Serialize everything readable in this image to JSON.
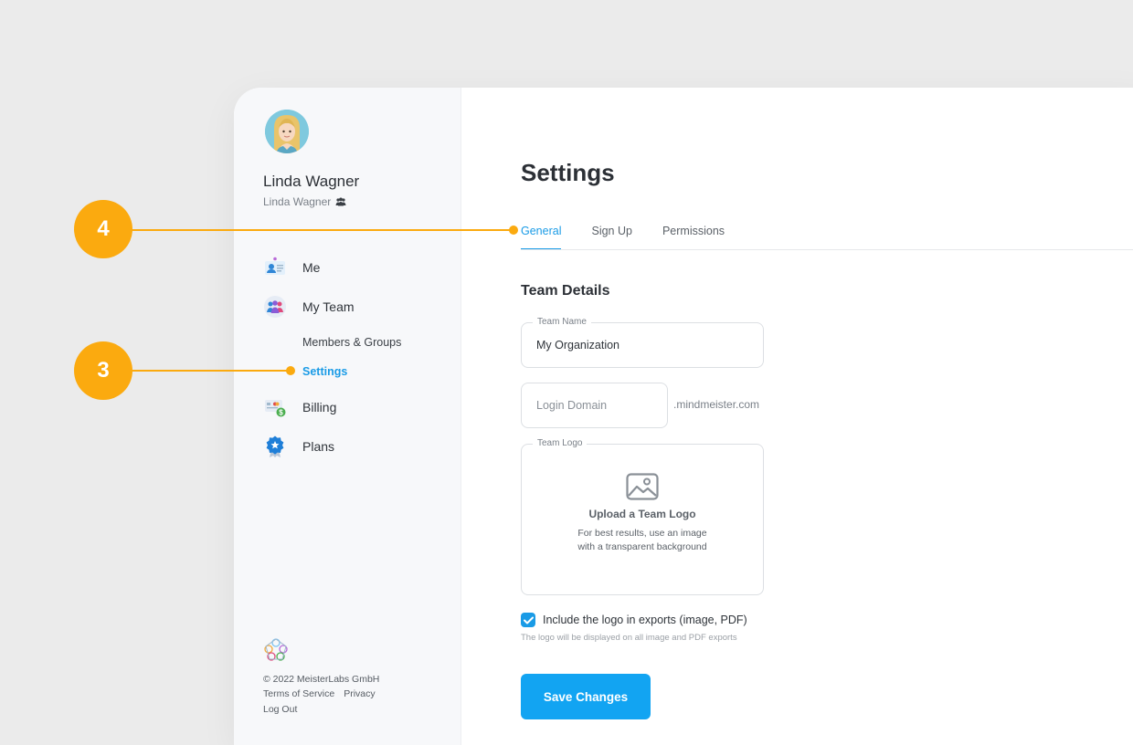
{
  "user": {
    "name": "Linda Wagner",
    "subtitle": "Linda Wagner"
  },
  "sidebar": {
    "items": [
      {
        "label": "Me"
      },
      {
        "label": "My Team"
      },
      {
        "label": "Billing"
      },
      {
        "label": "Plans"
      }
    ],
    "subitems": [
      {
        "label": "Members & Groups"
      },
      {
        "label": "Settings"
      }
    ],
    "footer": {
      "copyright": "© 2022 MeisterLabs GmbH",
      "terms": "Terms of Service",
      "privacy": "Privacy",
      "logout": "Log Out"
    }
  },
  "page": {
    "title": "Settings",
    "tabs": [
      {
        "label": "General"
      },
      {
        "label": "Sign Up"
      },
      {
        "label": "Permissions"
      }
    ],
    "section_title": "Team Details",
    "team_name": {
      "label": "Team Name",
      "value": "My Organization"
    },
    "login_domain": {
      "placeholder": "Login Domain",
      "suffix": ".mindmeister.com"
    },
    "team_logo": {
      "label": "Team Logo",
      "title": "Upload a Team Logo",
      "hint_line1": "For best results, use an image",
      "hint_line2": "with a transparent background"
    },
    "include_logo": {
      "label": "Include the logo in exports (image, PDF)",
      "hint": "The logo will be displayed on all image and PDF exports",
      "checked": true
    },
    "save_label": "Save Changes"
  },
  "callouts": [
    {
      "number": "4"
    },
    {
      "number": "3"
    }
  ],
  "colors": {
    "accent": "#1a9be6",
    "button": "#12a4f2",
    "callout": "#fbaa0f"
  }
}
